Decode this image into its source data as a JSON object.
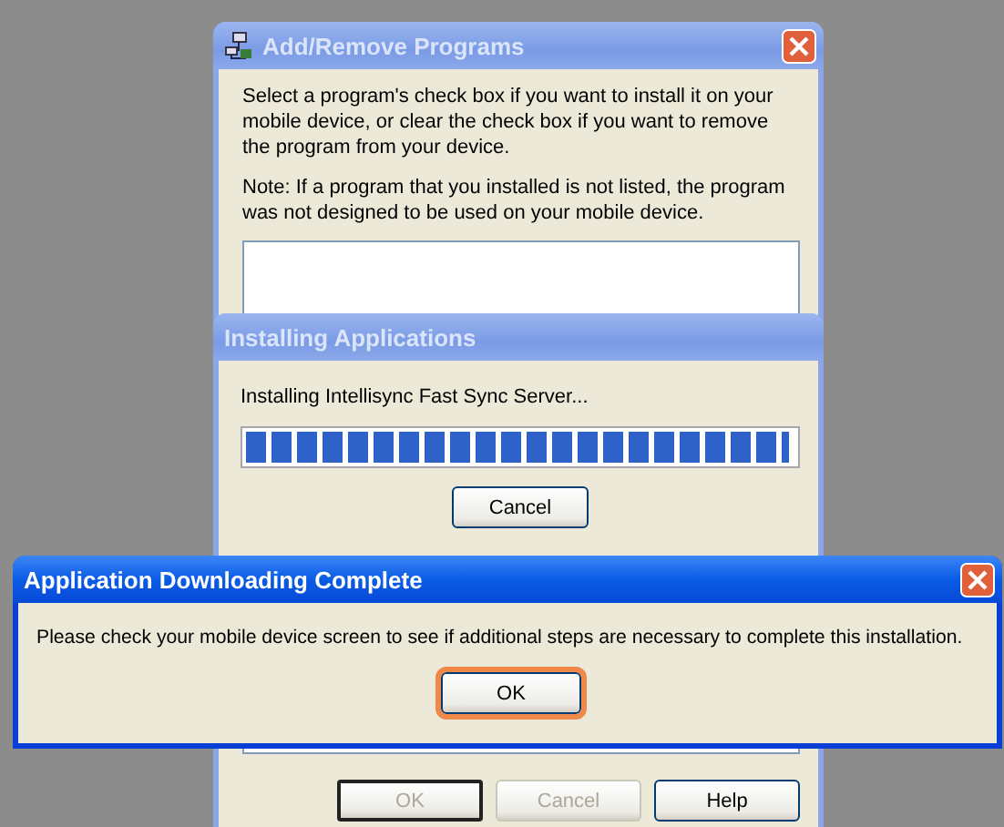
{
  "program_window": {
    "title": "Add/Remove Programs",
    "active": false,
    "description": "Select a program's check box if you want to install it on your mobile device, or clear the check box if you want to remove the program from your device.",
    "note": "Note:  If a program that you installed is not listed, the program was not designed to be used on your mobile device.",
    "buttons": [
      {
        "label": "OK",
        "disabled": true
      },
      {
        "label": "Cancel",
        "disabled": true
      },
      {
        "label": "Help",
        "disabled": false
      }
    ]
  },
  "progress_dialog": {
    "title": "Installing Applications",
    "active": false,
    "status": "Installing Intellisync Fast Sync Server...",
    "level": 0.99,
    "cancel_button": "Cancel"
  },
  "alert_dialog": {
    "title": "Application Downloading Complete",
    "active": true,
    "message": "Please check your mobile device screen to see if additional steps are necessary to complete this installation.",
    "ok_button": {
      "label": "OK",
      "focused": true
    }
  }
}
